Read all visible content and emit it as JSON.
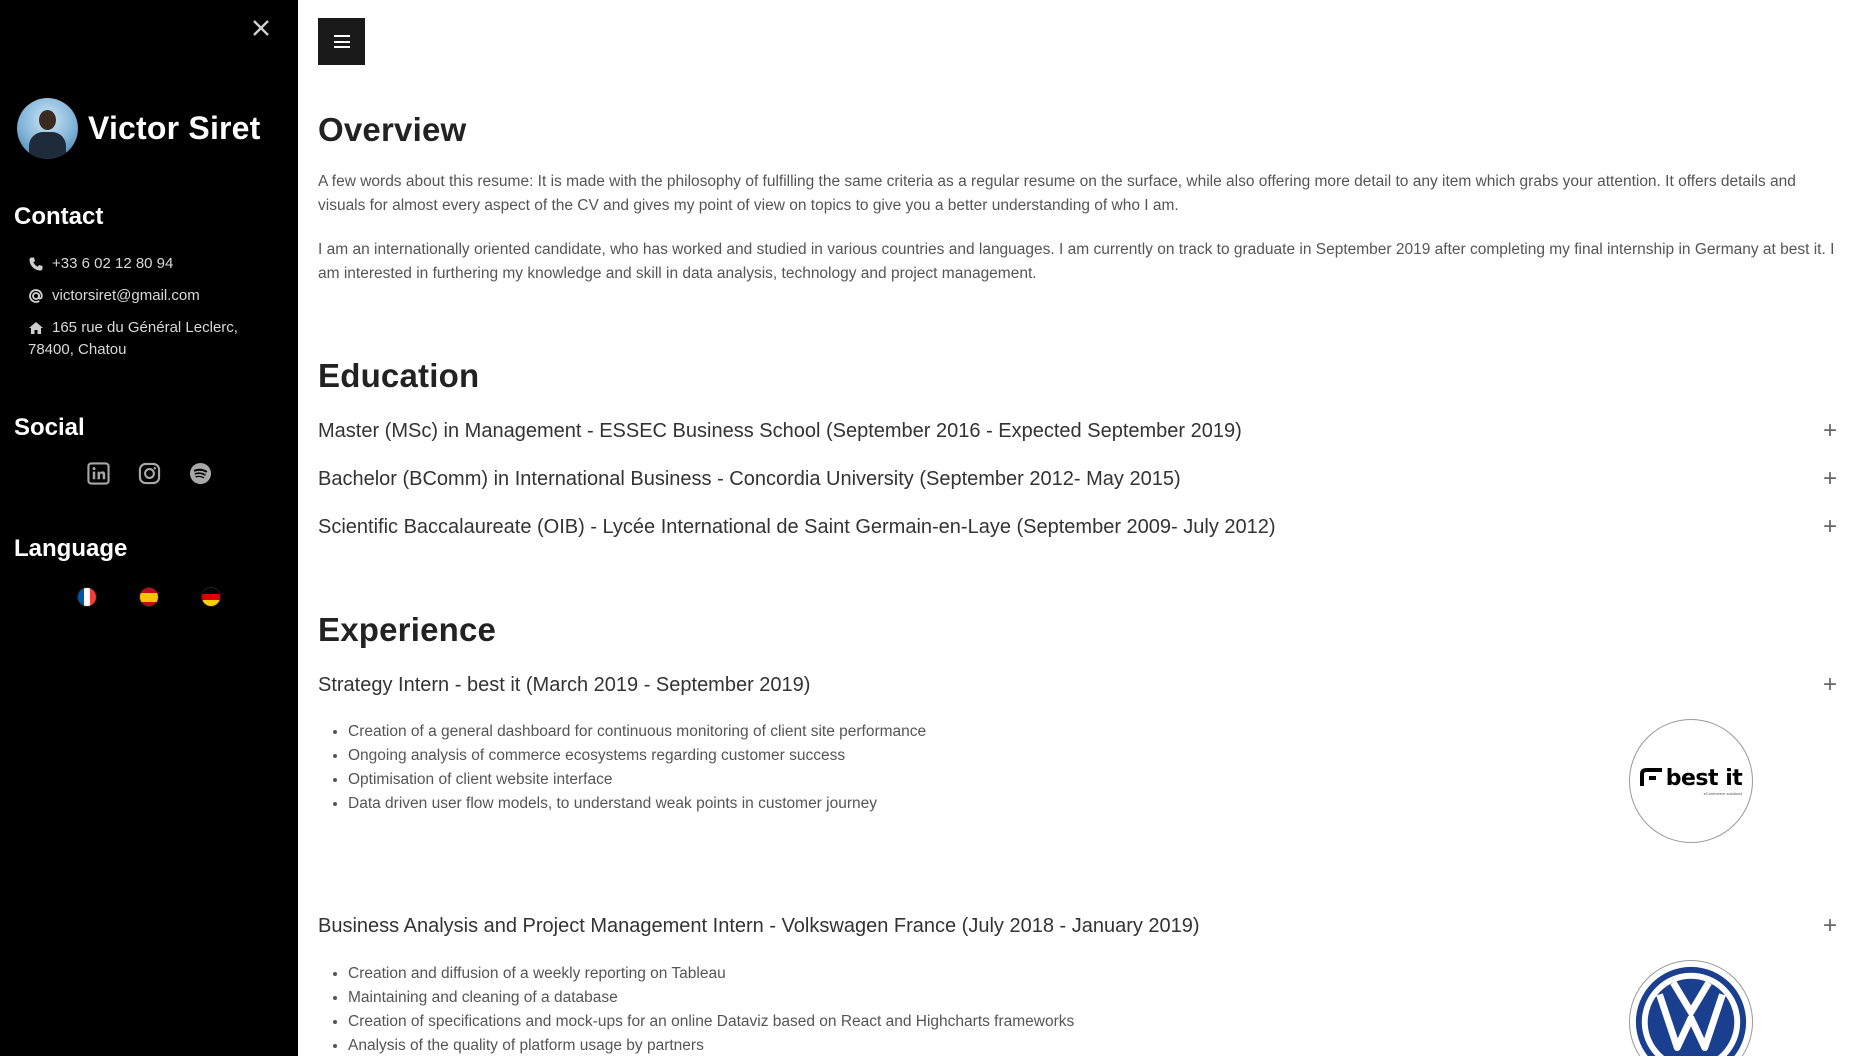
{
  "sidebar": {
    "name": "Victor Siret",
    "contact_title": "Contact",
    "phone": "+33 6 02 12 80 94",
    "email": "victorsiret@gmail.com",
    "address_line1": "165 rue du Général Leclerc,",
    "address_line2": "78400, Chatou",
    "social_title": "Social",
    "social_icons": [
      "linkedin-icon",
      "instagram-icon",
      "spotify-icon"
    ],
    "language_title": "Language",
    "languages": [
      {
        "code": "fr",
        "colors": [
          "#0055a4",
          "#ffffff",
          "#ef4135"
        ]
      },
      {
        "code": "es",
        "colors": [
          "#c60b1e",
          "#ffc400",
          "#c60b1e"
        ]
      },
      {
        "code": "de",
        "colors": [
          "#000000",
          "#dd0000",
          "#ffce00"
        ]
      }
    ]
  },
  "main": {
    "overview": {
      "title": "Overview",
      "para1": "A few words about this resume: It is made with the philosophy of fulfilling the same criteria as a regular resume on the surface, while also offering more detail to any item which grabs your attention. It offers details and visuals for almost every aspect of the CV and gives my point of view on topics to give you a better understanding of who I am.",
      "para2": "I am an internationally oriented candidate, who has worked and studied in various countries and languages. I am currently on track to graduate in September 2019 after completing my final internship in Germany at best it. I am interested in furthering my knowledge and skill in data analysis, technology and project management."
    },
    "education": {
      "title": "Education",
      "items": [
        "Master (MSc) in Management - ESSEC Business School (September 2016 - Expected September 2019)",
        "Bachelor (BComm) in International Business - Concordia University (September 2012- May 2015)",
        "Scientific Baccalaureate (OIB) - Lycée International de Saint Germain-en-Laye (September 2009- July 2012)"
      ]
    },
    "experience": {
      "title": "Experience",
      "jobs": [
        {
          "title": "Strategy Intern - best it (March 2019 - September 2019)",
          "bullets": [
            "Creation of a general dashboard for continuous monitoring of client site performance",
            "Ongoing analysis of commerce ecosystems regarding customer success",
            "Optimisation of client website interface",
            "Data driven user flow models, to understand weak points in customer journey"
          ],
          "logo_text": "best it",
          "logo_sub": "eCommerce solutions"
        },
        {
          "title": "Business Analysis and Project Management Intern - Volkswagen France (July 2018 - January 2019)",
          "bullets": [
            "Creation and diffusion of a weekly reporting on Tableau",
            "Maintaining and cleaning of a database",
            "Creation of specifications and mock-ups for an online Dataviz based on React and Highcharts frameworks",
            "Analysis of the quality of platform usage by partners"
          ]
        }
      ]
    },
    "expand_symbol": "+",
    "accent": "#000000"
  }
}
